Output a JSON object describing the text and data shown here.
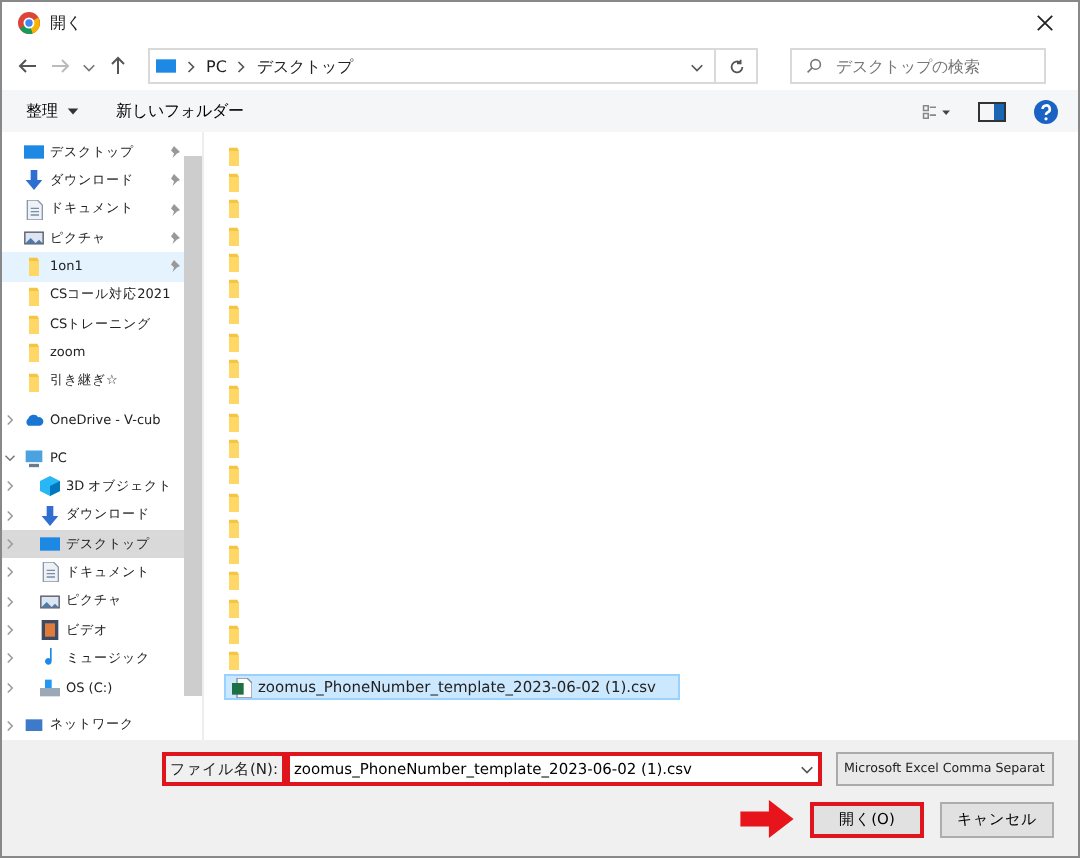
{
  "window": {
    "title": "開く"
  },
  "address_bar": {
    "path": [
      "PC",
      "デスクトップ"
    ]
  },
  "search": {
    "placeholder": "デスクトップの検索"
  },
  "toolbar": {
    "organize": "整理",
    "new_folder": "新しいフォルダー"
  },
  "navigation": [
    {
      "kind": "desktop",
      "label": "デスクトップ",
      "pinned": true,
      "selected": false,
      "highlighted": false
    },
    {
      "kind": "download",
      "label": "ダウンロード",
      "pinned": true,
      "selected": false,
      "highlighted": false
    },
    {
      "kind": "document",
      "label": "ドキュメント",
      "pinned": true,
      "selected": false,
      "highlighted": false
    },
    {
      "kind": "picture",
      "label": "ピクチャ",
      "pinned": true,
      "selected": false,
      "highlighted": false
    },
    {
      "kind": "folder",
      "label": "1on1",
      "pinned": true,
      "selected": false,
      "highlighted": true
    },
    {
      "kind": "folder",
      "label": "CSコール対応2021",
      "pinned": false,
      "selected": false,
      "highlighted": false
    },
    {
      "kind": "folder",
      "label": "CSトレーニング",
      "pinned": false,
      "selected": false,
      "highlighted": false
    },
    {
      "kind": "folder",
      "label": "zoom",
      "pinned": false,
      "selected": false,
      "highlighted": false
    },
    {
      "kind": "folder",
      "label": "引き継ぎ☆",
      "pinned": false,
      "selected": false,
      "highlighted": false
    },
    {
      "kind": "cloud",
      "label": "OneDrive - V-cub",
      "expanded": false,
      "selected": false,
      "highlighted": false
    },
    {
      "kind": "pc",
      "label": "PC",
      "expanded": true,
      "selected": false,
      "highlighted": false,
      "children": [
        {
          "kind": "cube",
          "label": "3D オブジェクト",
          "expanded": false,
          "selected": false,
          "highlighted": false
        },
        {
          "kind": "download",
          "label": "ダウンロード",
          "expanded": false,
          "selected": false,
          "highlighted": false
        },
        {
          "kind": "desktop",
          "label": "デスクトップ",
          "expanded": false,
          "selected": true,
          "highlighted": false
        },
        {
          "kind": "document",
          "label": "ドキュメント",
          "expanded": false,
          "selected": false,
          "highlighted": false
        },
        {
          "kind": "picture",
          "label": "ピクチャ",
          "expanded": false,
          "selected": false,
          "highlighted": false
        },
        {
          "kind": "video",
          "label": "ビデオ",
          "expanded": false,
          "selected": false,
          "highlighted": false
        },
        {
          "kind": "music",
          "label": "ミュージック",
          "expanded": false,
          "selected": false,
          "highlighted": false
        },
        {
          "kind": "drive",
          "label": "OS (C:)",
          "expanded": false,
          "selected": false,
          "highlighted": false
        }
      ]
    },
    {
      "kind": "network",
      "label": "ネットワーク",
      "expanded": false,
      "selected": false,
      "highlighted": false
    }
  ],
  "files": [
    {
      "kind": "folder",
      "selected": false
    },
    {
      "kind": "folder",
      "selected": false
    },
    {
      "kind": "folder",
      "selected": false
    },
    {
      "kind": "folder",
      "selected": false
    },
    {
      "kind": "folder",
      "selected": false
    },
    {
      "kind": "folder",
      "selected": false
    },
    {
      "kind": "folder",
      "selected": false
    },
    {
      "kind": "folder",
      "selected": false
    },
    {
      "kind": "folder",
      "selected": false
    },
    {
      "kind": "folder",
      "selected": false
    },
    {
      "kind": "folder",
      "selected": false
    },
    {
      "kind": "folder",
      "selected": false
    },
    {
      "kind": "folder",
      "selected": false
    },
    {
      "kind": "folder",
      "selected": false
    },
    {
      "kind": "folder",
      "selected": false
    },
    {
      "kind": "folder",
      "selected": false
    },
    {
      "kind": "folder",
      "selected": false
    },
    {
      "kind": "folder",
      "selected": false
    },
    {
      "kind": "folder",
      "selected": false
    },
    {
      "kind": "folder",
      "selected": false
    },
    {
      "kind": "csv",
      "name": "zoomus_PhoneNumber_template_2023-06-02 (1).csv",
      "selected": true
    }
  ],
  "file_name": {
    "label": "ファイル名(N):",
    "value": "zoomus_PhoneNumber_template_2023-06-02 (1).csv",
    "annotated": true
  },
  "file_type": {
    "value": "Microsoft Excel Comma Separat"
  },
  "buttons": [
    {
      "kind": "primary",
      "label": "開く(O)",
      "annotated": true,
      "arrow": true
    },
    {
      "kind": "secondary",
      "label": "キャンセル",
      "annotated": false,
      "arrow": false
    }
  ]
}
